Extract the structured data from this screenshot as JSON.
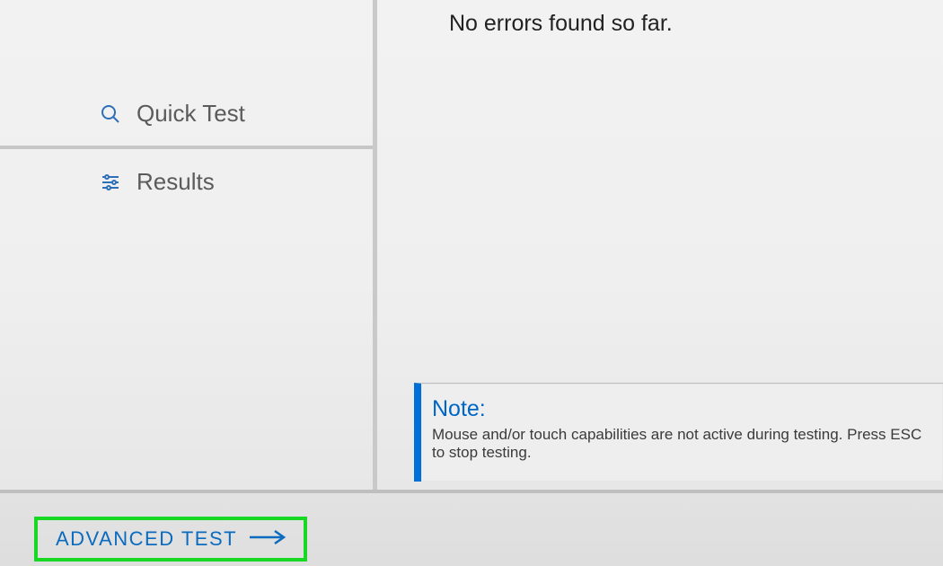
{
  "sidebar": {
    "items": [
      {
        "label": "Quick Test",
        "icon": "search"
      },
      {
        "label": "Results",
        "icon": "sliders"
      }
    ]
  },
  "main": {
    "status": "No errors found so far.",
    "note": {
      "title": "Note:",
      "body": "Mouse and/or touch capabilities are not active during testing. Press ESC to stop testing."
    }
  },
  "footer": {
    "advanced_label": "ADVANCED TEST"
  }
}
